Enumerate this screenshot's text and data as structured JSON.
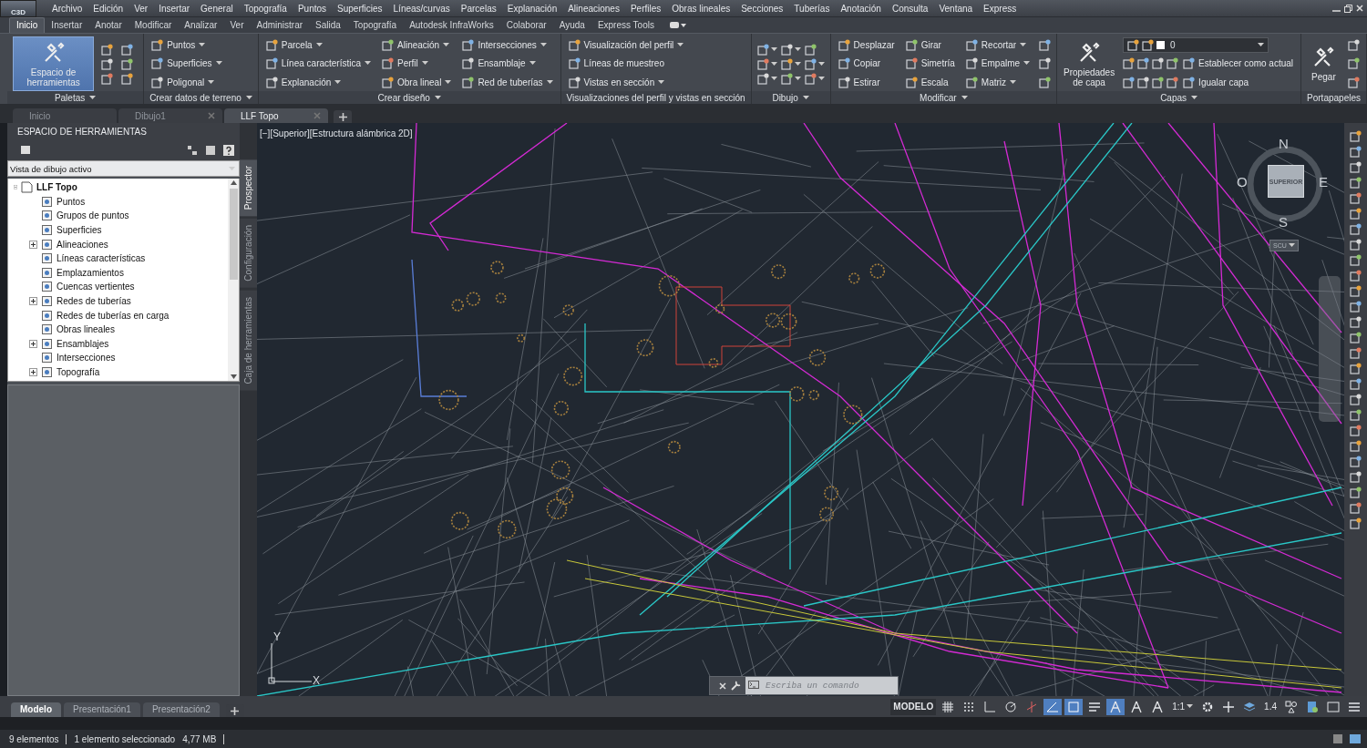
{
  "app_logo": "C3D",
  "menu": [
    "Archivo",
    "Edición",
    "Ver",
    "Insertar",
    "General",
    "Topografía",
    "Puntos",
    "Superficies",
    "Líneas/curvas",
    "Parcelas",
    "Explanación",
    "Alineaciones",
    "Perfiles",
    "Obras lineales",
    "Secciones",
    "Tuberías",
    "Anotación",
    "Consulta",
    "Ventana",
    "Express"
  ],
  "ribbon_tabs": [
    {
      "label": "Inicio",
      "selected": true
    },
    {
      "label": "Insertar",
      "selected": false
    },
    {
      "label": "Anotar",
      "selected": false
    },
    {
      "label": "Modificar",
      "selected": false
    },
    {
      "label": "Analizar",
      "selected": false
    },
    {
      "label": "Ver",
      "selected": false
    },
    {
      "label": "Administrar",
      "selected": false
    },
    {
      "label": "Salida",
      "selected": false
    },
    {
      "label": "Topografía",
      "selected": false
    },
    {
      "label": "Autodesk InfraWorks",
      "selected": false
    },
    {
      "label": "Colaborar",
      "selected": false
    },
    {
      "label": "Ayuda",
      "selected": false
    },
    {
      "label": "Express Tools",
      "selected": false
    }
  ],
  "ribbon_panels": [
    {
      "kind": "palettes",
      "title": "Paletas",
      "menu": true,
      "big": {
        "label": "Espacio de herramientas",
        "selected": true
      }
    },
    {
      "kind": "tools",
      "title": "Crear datos de terreno",
      "menu": true,
      "columns": [
        [
          {
            "label": "Puntos",
            "dropdown": true
          },
          {
            "label": "Superficies",
            "dropdown": true
          },
          {
            "label": "Poligonal",
            "dropdown": true
          }
        ]
      ]
    },
    {
      "kind": "tools",
      "title": "Crear diseño",
      "menu": true,
      "columns": [
        [
          {
            "label": "Parcela",
            "dropdown": true
          },
          {
            "label": "Línea característica",
            "dropdown": true
          },
          {
            "label": "Explanación",
            "dropdown": true
          }
        ],
        [
          {
            "label": "Alineación",
            "dropdown": true
          },
          {
            "label": "Perfil",
            "dropdown": true
          },
          {
            "label": "Obra lineal",
            "dropdown": true
          }
        ],
        [
          {
            "label": "Intersecciones",
            "dropdown": true
          },
          {
            "label": "Ensamblaje",
            "dropdown": true
          },
          {
            "label": "Red de tuberías",
            "dropdown": true
          }
        ]
      ]
    },
    {
      "kind": "tools",
      "title": "Visualizaciones del perfil y vistas en sección",
      "menu": false,
      "columns": [
        [
          {
            "label": "Visualización del perfil",
            "dropdown": true
          },
          {
            "label": "Líneas de muestreo",
            "dropdown": false
          },
          {
            "label": "Vistas en sección",
            "dropdown": true
          }
        ]
      ]
    },
    {
      "kind": "draw",
      "title": "Dibujo",
      "menu": true
    },
    {
      "kind": "modify",
      "title": "Modificar",
      "menu": true,
      "columns": [
        [
          {
            "label": "Desplazar",
            "dropdown": false
          },
          {
            "label": "Copiar",
            "dropdown": false
          },
          {
            "label": "Estirar",
            "dropdown": false
          }
        ],
        [
          {
            "label": "Girar",
            "dropdown": false
          },
          {
            "label": "Simetría",
            "dropdown": false
          },
          {
            "label": "Escala",
            "dropdown": false
          }
        ],
        [
          {
            "label": "Recortar",
            "dropdown": true
          },
          {
            "label": "Empalme",
            "dropdown": true
          },
          {
            "label": "Matriz",
            "dropdown": true
          }
        ]
      ]
    },
    {
      "kind": "layers",
      "title": "Capas",
      "menu": true,
      "big": {
        "label": "Propiedades de capa",
        "selected": false
      },
      "layer": "0",
      "columns": [
        [
          {
            "label": "Establecer como actual"
          },
          {
            "label": "Igualar capa"
          }
        ]
      ]
    },
    {
      "kind": "clipboard",
      "title": "Portapapeles",
      "menu": false,
      "big": {
        "label": "Pegar",
        "selected": false
      }
    }
  ],
  "document_tabs": [
    {
      "label": "Inicio",
      "selected": false,
      "closable": false
    },
    {
      "label": "Dibujo1",
      "selected": false,
      "closable": true
    },
    {
      "label": "LLF Topo",
      "selected": true,
      "closable": true
    }
  ],
  "toolspace": {
    "title": "ESPACIO DE HERRAMIENTAS",
    "view": "Vista de dibujo activo",
    "tree": [
      {
        "label": "LLF Topo",
        "expanded": true,
        "children": [
          {
            "label": "Puntos"
          },
          {
            "label": "Grupos de puntos"
          },
          {
            "label": "Superficies"
          },
          {
            "label": "Alineaciones",
            "expanded": false
          },
          {
            "label": "Líneas características"
          },
          {
            "label": "Emplazamientos"
          },
          {
            "label": "Cuencas vertientes"
          },
          {
            "label": "Redes de tuberías",
            "expanded": false
          },
          {
            "label": "Redes de tuberías en carga"
          },
          {
            "label": "Obras lineales"
          },
          {
            "label": "Ensamblajes",
            "expanded": false
          },
          {
            "label": "Intersecciones"
          },
          {
            "label": "Topografía",
            "expanded": false
          }
        ]
      }
    ],
    "side_tabs": [
      {
        "label": "Prospector",
        "selected": true
      },
      {
        "label": "Configuración",
        "selected": false
      },
      {
        "label": "Caja de herramientas",
        "selected": false
      }
    ]
  },
  "viewport": {
    "label": "[−][Superior][Estructura alámbrica 2D]",
    "viewcube": {
      "north": "N",
      "south": "S",
      "east": "E",
      "west": "O",
      "face": "SUPERIOR",
      "ucs": "SCU"
    },
    "ucs_icon": {
      "x": "X",
      "y": "Y"
    }
  },
  "command_line": {
    "placeholder": "Escriba un comando"
  },
  "layout_tabs": [
    {
      "label": "Modelo",
      "selected": true
    },
    {
      "label": "Presentación1",
      "selected": false
    },
    {
      "label": "Presentación2",
      "selected": false
    }
  ],
  "status_tools": [
    {
      "kind": "model",
      "label": "MODELO"
    },
    {
      "kind": "grid",
      "on": false
    },
    {
      "kind": "snap",
      "on": false
    },
    {
      "kind": "ortho",
      "on": false
    },
    {
      "kind": "polar",
      "on": false
    },
    {
      "kind": "isodraft",
      "on": false
    },
    {
      "kind": "track",
      "on": true
    },
    {
      "kind": "osnap",
      "on": true
    },
    {
      "kind": "lineweight",
      "on": false
    },
    {
      "kind": "annovisible",
      "on": true
    },
    {
      "kind": "autoscale",
      "on": false
    },
    {
      "kind": "annoscale",
      "on": false
    },
    {
      "kind": "scale",
      "label": "1:1"
    },
    {
      "kind": "workspace"
    },
    {
      "kind": "plus"
    },
    {
      "kind": "units"
    },
    {
      "kind": "precision",
      "label": "1.4"
    },
    {
      "kind": "isolate"
    },
    {
      "kind": "hardware"
    },
    {
      "kind": "fullscreen"
    },
    {
      "kind": "menu"
    }
  ],
  "status_bar": [
    "9 elementos",
    "1 elemento seleccionado",
    "4,77 MB"
  ]
}
